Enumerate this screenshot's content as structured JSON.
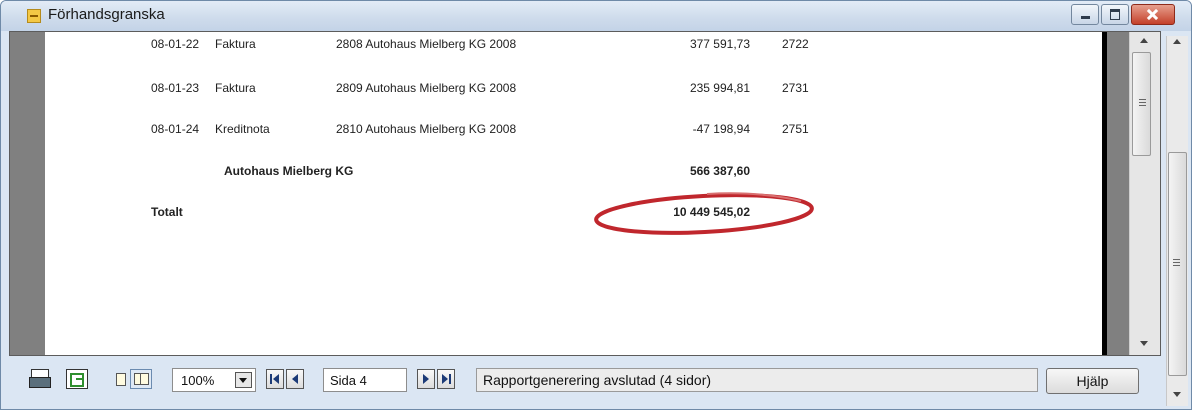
{
  "window": {
    "title": "Förhandsgranska"
  },
  "report": {
    "rows": [
      {
        "date": "08-01-22",
        "type": "Faktura",
        "reference": "2808 Autohaus Mielberg KG 2008",
        "amount": "377 591,73",
        "number": "2722"
      },
      {
        "date": "08-01-23",
        "type": "Faktura",
        "reference": "2809 Autohaus Mielberg KG 2008",
        "amount": "235 994,81",
        "number": "2731"
      },
      {
        "date": "08-01-24",
        "type": "Kreditnota",
        "reference": "2810 Autohaus Mielberg KG 2008",
        "amount": "-47 198,94",
        "number": "2751"
      }
    ],
    "subtotal": {
      "label": "Autohaus Mielberg KG",
      "amount": "566 387,60"
    },
    "total": {
      "label": "Totalt",
      "amount": "10 449 545,02"
    },
    "highlight_color": "#c0272d"
  },
  "toolbar": {
    "zoom": "100%",
    "page": "Sida 4",
    "status": "Rapportgenerering avslutad (4 sidor)",
    "help_label": "Hjälp"
  },
  "icons": [
    "print-icon",
    "export-icon",
    "single-page-icon",
    "two-page-icon",
    "first-page-icon",
    "previous-page-icon",
    "next-page-icon",
    "last-page-icon"
  ]
}
